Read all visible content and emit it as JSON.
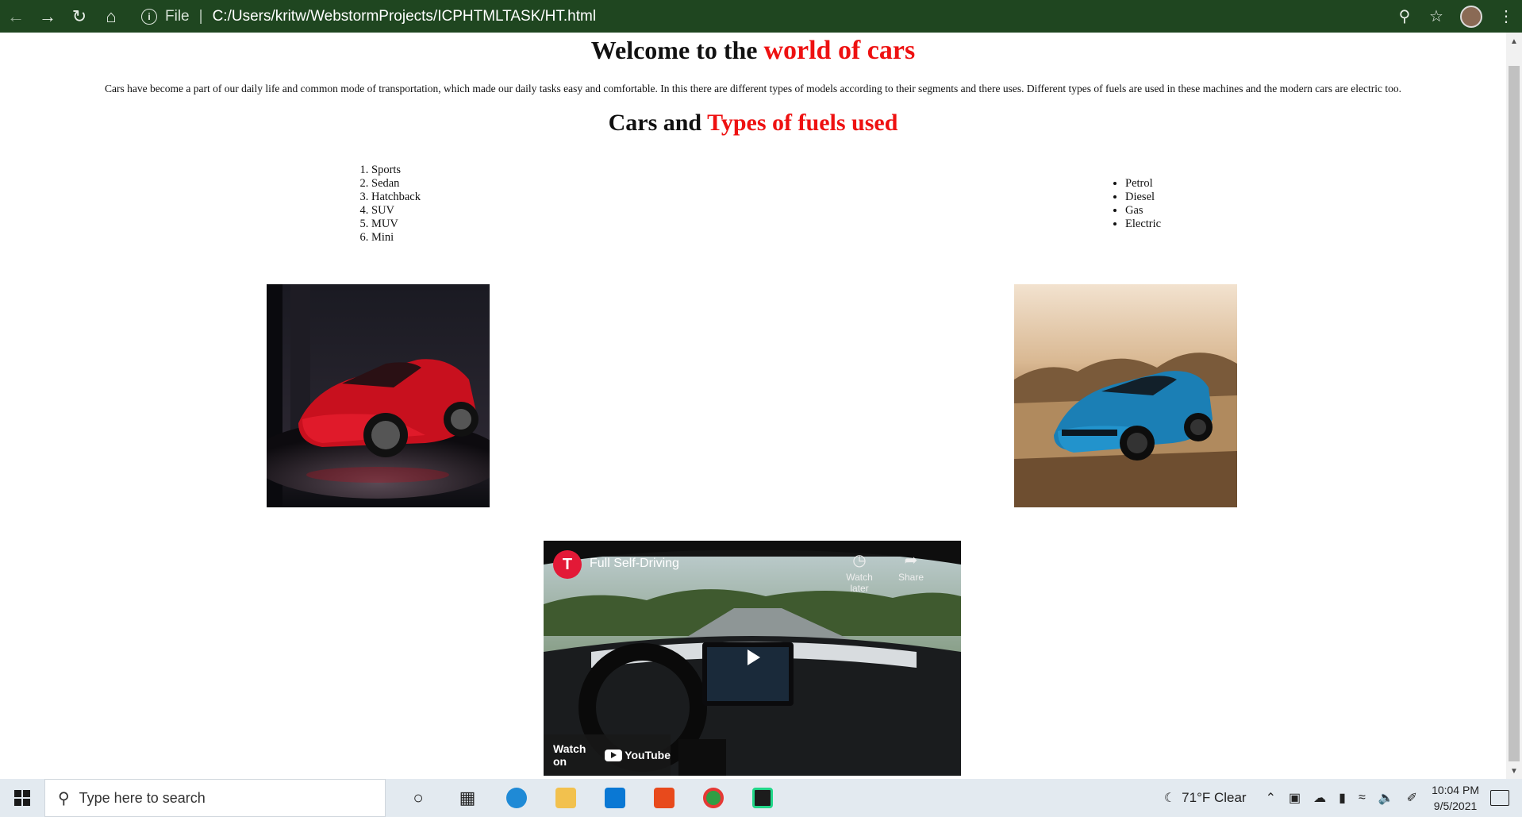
{
  "browser": {
    "file_label": "File",
    "url": "C:/Users/kritw/WebstormProjects/ICPHTMLTASK/HT.html",
    "chrome_color": "#1f4620"
  },
  "page": {
    "heading_plain": "Welcome to the",
    "heading_red": "world of cars",
    "paragraph": "Cars have become a part of our daily life and common mode of transportation, which made our daily tasks easy and comfortable. In this there are different types of models according to their segments and there uses. Different types of fuels are used in these machines and the modern cars are electric too.",
    "subheading_plain": "Cars and",
    "subheading_red": "Types of fuels used",
    "accent_color": "#ee1111",
    "car_types": [
      "Sports",
      "Sedan",
      "Hatchback",
      "SUV",
      "MUV",
      "Mini"
    ],
    "fuel_types": [
      "Petrol",
      "Diesel",
      "Gas",
      "Electric"
    ],
    "video": {
      "title": "Full Self-Driving",
      "watch_later": "Watch later",
      "share": "Share",
      "watch_on": "Watch on",
      "youtube": "YouTube"
    }
  },
  "taskbar": {
    "search_placeholder": "Type here to search",
    "weather": "71°F  Clear",
    "time": "10:04 PM",
    "date": "9/5/2021"
  }
}
